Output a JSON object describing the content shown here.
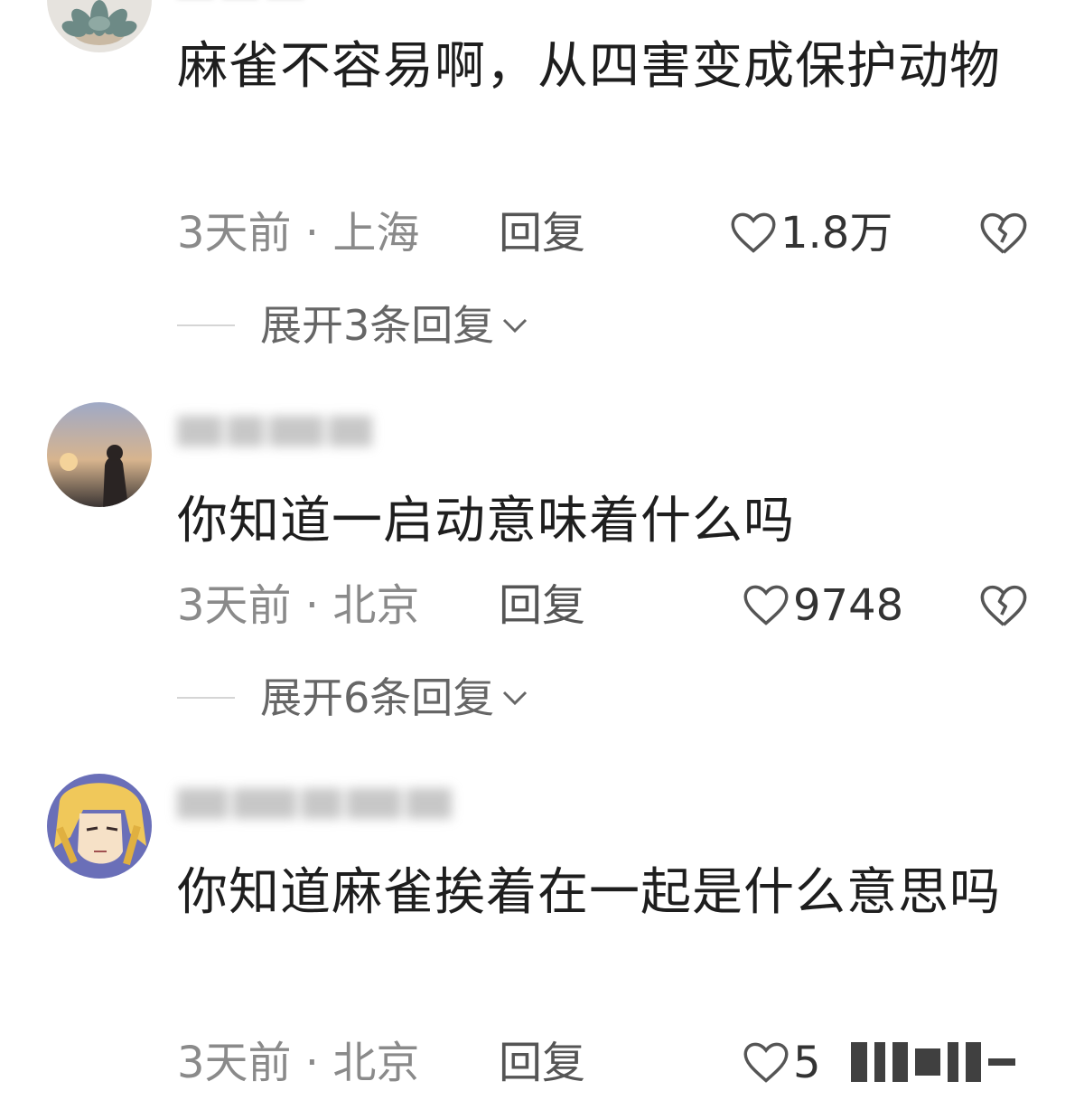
{
  "comments": [
    {
      "text": "麻雀不容易啊，从四害变成保护动物",
      "time_location": "3天前 · 上海",
      "reply_label": "回复",
      "likes": "1.8万",
      "expand_label": "展开3条回复"
    },
    {
      "text": "你知道一启动意味着什么吗",
      "time_location": "3天前 · 北京",
      "reply_label": "回复",
      "likes": "9748",
      "expand_label": "展开6条回复"
    },
    {
      "text": "你知道麻雀挨着在一起是什么意思吗",
      "time_location": "3天前 · 北京",
      "reply_label": "回复",
      "likes": "5"
    }
  ],
  "icons": {
    "like": "heart-outline-icon",
    "dislike": "broken-heart-icon",
    "expand": "chevron-down-icon"
  },
  "colors": {
    "text": "#1e1e1e",
    "meta": "#8a8a8a",
    "like_count": "#333333"
  }
}
